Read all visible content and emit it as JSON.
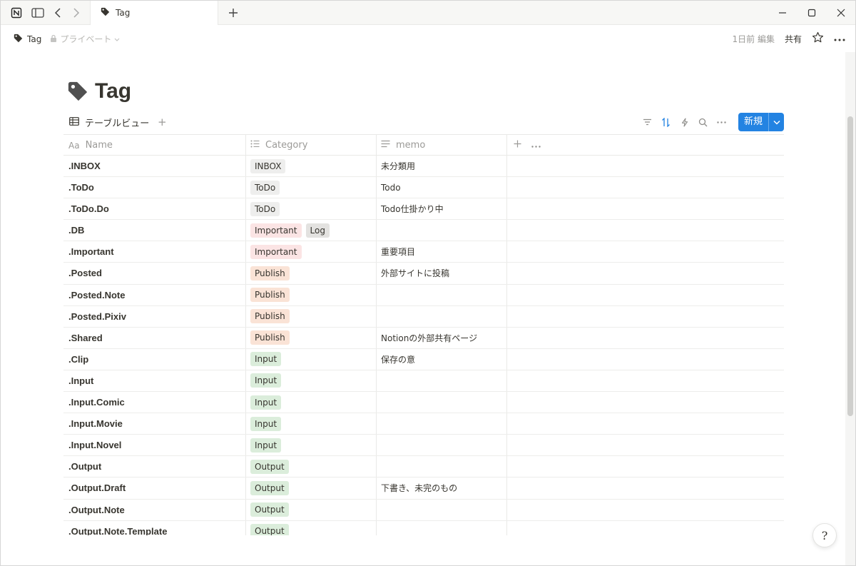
{
  "tab": {
    "label": "Tag"
  },
  "breadcrumb": {
    "page": "Tag",
    "privacy": "プライベート"
  },
  "topbar": {
    "edited": "1日前 編集",
    "share": "共有"
  },
  "page": {
    "title": "Tag"
  },
  "view": {
    "name": "テーブルビュー",
    "new_label": "新規"
  },
  "columns": {
    "name": "Name",
    "category": "Category",
    "memo": "memo"
  },
  "colors": {
    "accent": "#2383e2",
    "tag_gray": "#eeeeed",
    "tag_red": "#fbe4e4",
    "tag_orange": "#fae3d6",
    "tag_green": "#dbeddb",
    "text": "#37352f"
  },
  "rows": [
    {
      "name": ".INBOX",
      "tags": [
        {
          "label": "INBOX",
          "color": "#eeeeed"
        }
      ],
      "memo": "未分類用"
    },
    {
      "name": ".ToDo",
      "tags": [
        {
          "label": "ToDo",
          "color": "#eeeeed"
        }
      ],
      "memo": "Todo"
    },
    {
      "name": ".ToDo.Do",
      "tags": [
        {
          "label": "ToDo",
          "color": "#eeeeed"
        }
      ],
      "memo": "Todo仕掛かり中"
    },
    {
      "name": ".DB",
      "tags": [
        {
          "label": "Important",
          "color": "#fbe4e4"
        },
        {
          "label": "Log",
          "color": "#e3e2e0"
        }
      ],
      "memo": ""
    },
    {
      "name": ".Important",
      "tags": [
        {
          "label": "Important",
          "color": "#fbe4e4"
        }
      ],
      "memo": "重要項目"
    },
    {
      "name": ".Posted",
      "tags": [
        {
          "label": "Publish",
          "color": "#fae3d6"
        }
      ],
      "memo": "外部サイトに投稿"
    },
    {
      "name": ".Posted.Note",
      "tags": [
        {
          "label": "Publish",
          "color": "#fae3d6"
        }
      ],
      "memo": ""
    },
    {
      "name": ".Posted.Pixiv",
      "tags": [
        {
          "label": "Publish",
          "color": "#fae3d6"
        }
      ],
      "memo": ""
    },
    {
      "name": ".Shared",
      "tags": [
        {
          "label": "Publish",
          "color": "#fae3d6"
        }
      ],
      "memo": "Notionの外部共有ページ"
    },
    {
      "name": ".Clip",
      "tags": [
        {
          "label": "Input",
          "color": "#dbeddb"
        }
      ],
      "memo": "保存の意"
    },
    {
      "name": ".Input",
      "tags": [
        {
          "label": "Input",
          "color": "#dbeddb"
        }
      ],
      "memo": ""
    },
    {
      "name": ".Input.Comic",
      "tags": [
        {
          "label": "Input",
          "color": "#dbeddb"
        }
      ],
      "memo": ""
    },
    {
      "name": ".Input.Movie",
      "tags": [
        {
          "label": "Input",
          "color": "#dbeddb"
        }
      ],
      "memo": ""
    },
    {
      "name": ".Input.Novel",
      "tags": [
        {
          "label": "Input",
          "color": "#dbeddb"
        }
      ],
      "memo": ""
    },
    {
      "name": ".Output",
      "tags": [
        {
          "label": "Output",
          "color": "#dbeddb"
        }
      ],
      "memo": ""
    },
    {
      "name": ".Output.Draft",
      "tags": [
        {
          "label": "Output",
          "color": "#dbeddb"
        }
      ],
      "memo": "下書き、未完のもの"
    },
    {
      "name": ".Output.Note",
      "tags": [
        {
          "label": "Output",
          "color": "#dbeddb"
        }
      ],
      "memo": ""
    },
    {
      "name": ".Output.Note.Template",
      "tags": [
        {
          "label": "Output",
          "color": "#dbeddb"
        }
      ],
      "memo": ""
    }
  ],
  "help": {
    "label": "?"
  }
}
